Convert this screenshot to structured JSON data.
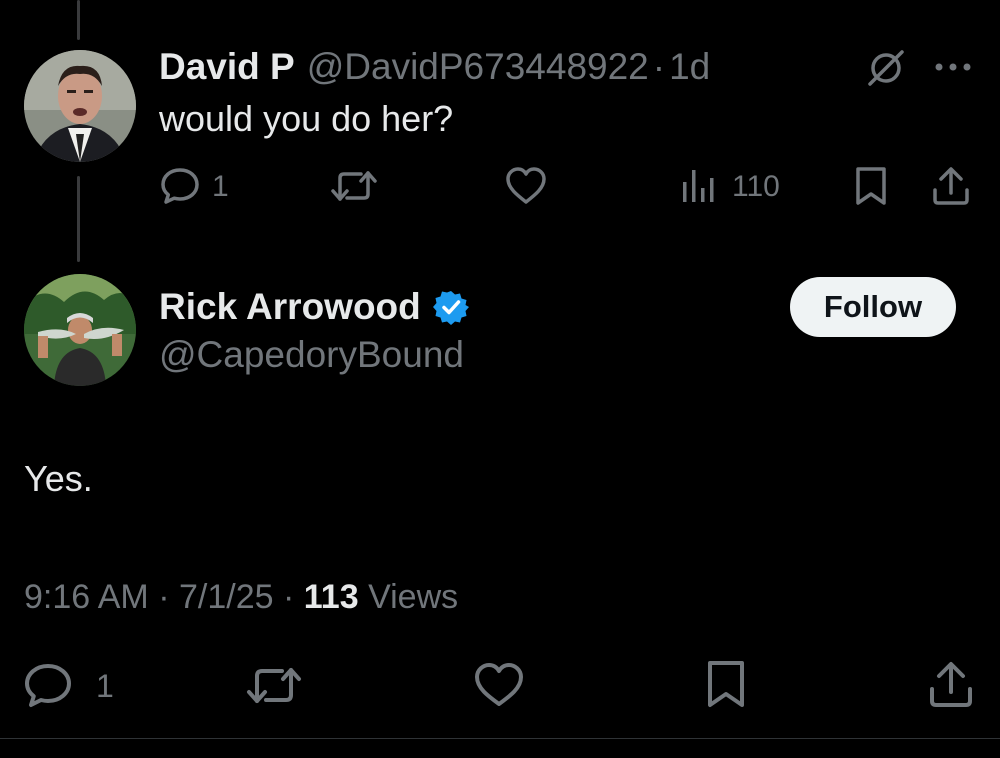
{
  "reply": {
    "author_name": "David P",
    "author_handle": "@DavidP673448922",
    "separator": "·",
    "time_ago": "1d",
    "text": "would you do her?",
    "reply_count": "1",
    "views_count": "110",
    "avatar_icon": "avatar-photo-man-in-suit"
  },
  "main_post": {
    "author_name": "Rick Arrowood",
    "author_handle": "@CapedoryBound",
    "verified": true,
    "verified_color": "#1d9bf0",
    "follow_label": "Follow",
    "text": "Yes.",
    "time": "9:16 AM",
    "date": "7/1/25",
    "separator": "·",
    "views_count": "113",
    "views_label": "Views",
    "reply_count": "1",
    "avatar_icon": "avatar-photo-man-holding-fish"
  },
  "icons": {
    "reply": "comment-bubble-icon",
    "retweet": "repost-icon",
    "like": "heart-icon",
    "views": "bar-chart-icon",
    "bookmark": "bookmark-icon",
    "share": "share-upload-icon",
    "grok": "grok-icon",
    "more": "more-dots-icon"
  },
  "colors": {
    "background": "#000000",
    "primary_text": "#e7e9ea",
    "secondary_text": "#71767b",
    "follow_bg": "#eff3f4"
  }
}
